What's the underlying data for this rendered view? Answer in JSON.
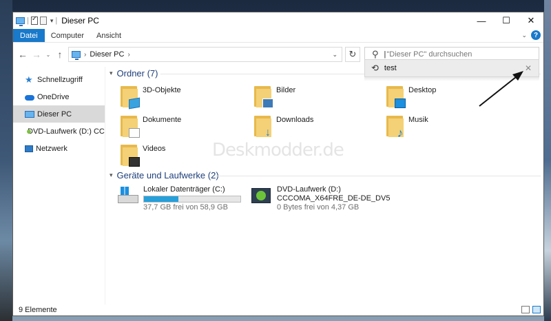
{
  "window": {
    "title": "Dieser PC"
  },
  "window_controls": {
    "minimize": "—",
    "maximize": "☐",
    "close": "✕"
  },
  "ribbon": {
    "tabs": [
      "Datei",
      "Computer",
      "Ansicht"
    ],
    "help": "?"
  },
  "address": {
    "location": "Dieser PC"
  },
  "search": {
    "placeholder": "\"Dieser PC\" durchsuchen"
  },
  "suggestion": {
    "text": "test"
  },
  "sidebar": {
    "items": [
      {
        "label": "Schnellzugriff"
      },
      {
        "label": "OneDrive"
      },
      {
        "label": "Dieser PC"
      },
      {
        "label": "DVD-Laufwerk (D:) CCCC"
      },
      {
        "label": "Netzwerk"
      }
    ]
  },
  "groups": {
    "folders": {
      "title": "Ordner (7)"
    },
    "drives": {
      "title": "Geräte und Laufwerke (2)"
    }
  },
  "folders": [
    "3D-Objekte",
    "Bilder",
    "Desktop",
    "Dokumente",
    "Downloads",
    "Musik",
    "Videos"
  ],
  "drives": [
    {
      "name": "Lokaler Datenträger (C:)",
      "free": "37,7 GB frei von 58,9 GB",
      "used_fraction": 0.36
    },
    {
      "name": "DVD-Laufwerk (D:)",
      "label": "CCCOMA_X64FRE_DE-DE_DV5",
      "free": "0 Bytes frei von 4,37 GB"
    }
  ],
  "status": {
    "count": "9 Elemente"
  },
  "watermark": "Deskmodder.de",
  "colors": {
    "accent": "#1979ca",
    "selection": "#d9d9d9",
    "drive_bar": "#26a0da",
    "group_header": "#1e3f7a"
  }
}
